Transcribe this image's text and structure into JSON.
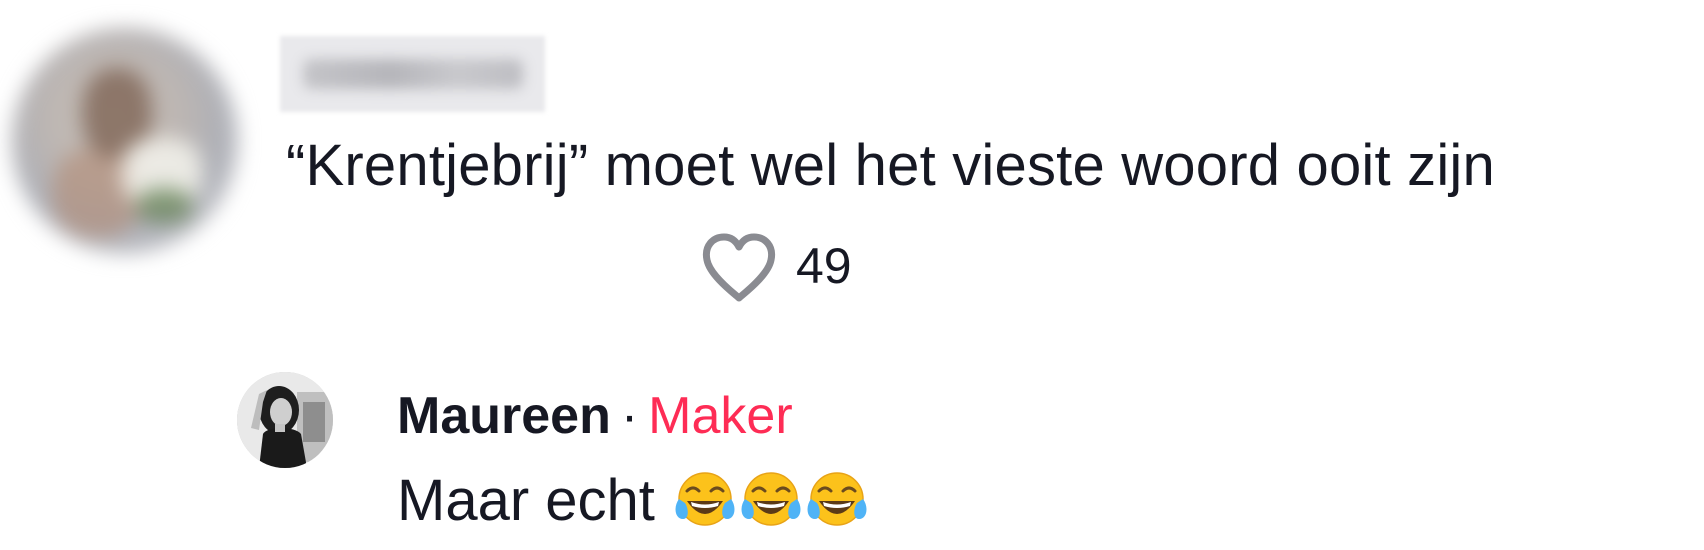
{
  "comment": {
    "text": "“Krentjebrij” moet wel het vieste woord ooit zijn",
    "like_count": "49",
    "like_icon": "heart-outline-icon"
  },
  "reply": {
    "author": "Maureen",
    "separator": "·",
    "badge": "Maker",
    "text": "Maar echt",
    "emoji": [
      "face-with-tears-of-joy-icon",
      "face-with-tears-of-joy-icon",
      "face-with-tears-of-joy-icon"
    ]
  },
  "colors": {
    "text": "#161823",
    "maker_badge": "#fe2c55",
    "like_icon": "#8a8b91"
  }
}
